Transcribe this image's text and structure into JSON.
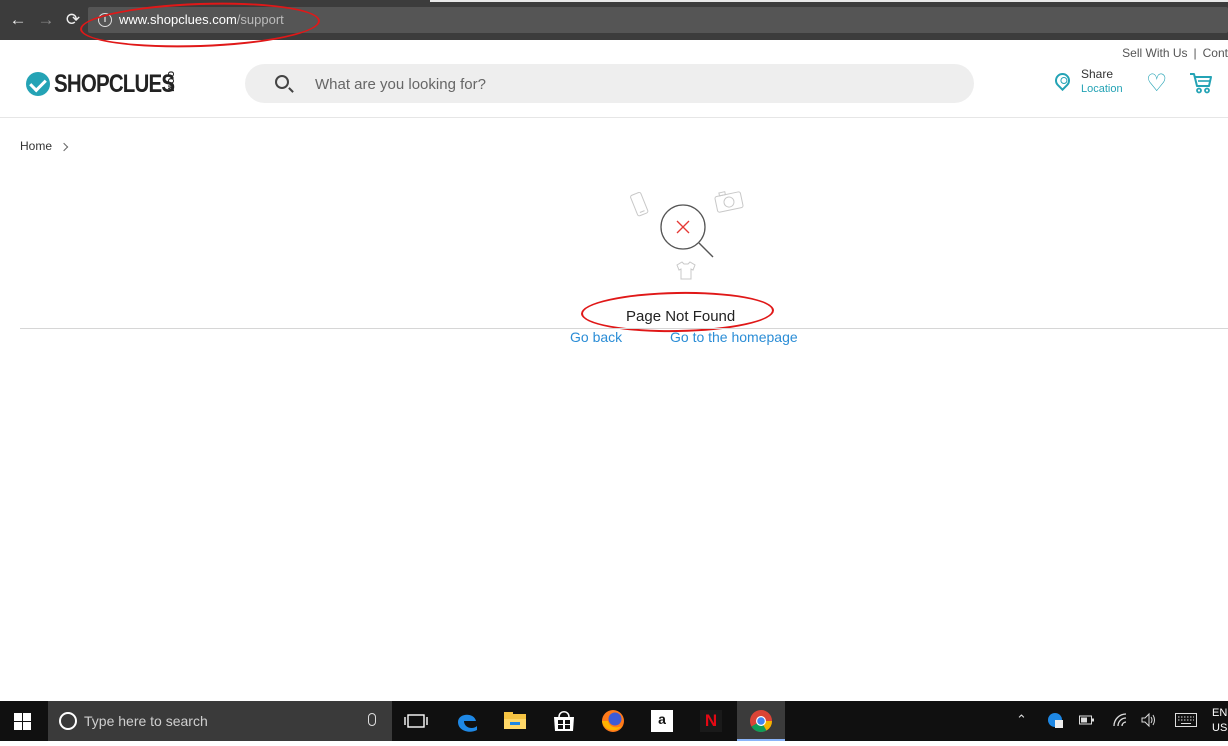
{
  "browser": {
    "back_glyph": "←",
    "forward_glyph": "→",
    "reload_glyph": "⟳",
    "info_glyph": "i",
    "url_host": "www.shopclues.com",
    "url_path": "/support"
  },
  "header": {
    "top_links": [
      "Sell With Us",
      "Cont"
    ],
    "top_separator": "|",
    "logo_word": "SHOPCLUES",
    "logo_suffix": "COM",
    "search_placeholder": "What are you looking for?",
    "share_label": "Share",
    "location_label": "Location",
    "heart_glyph": "♡"
  },
  "breadcrumb": {
    "home": "Home"
  },
  "error": {
    "title": "Page Not Found",
    "go_back": "Go back",
    "go_home": "Go to the homepage"
  },
  "taskbar": {
    "search_placeholder": "Type here to search",
    "amazon_glyph": "a",
    "netflix_glyph": "N",
    "tray_up_glyph": "⌃",
    "lang_line1": "EN",
    "lang_line2": "US"
  },
  "colors": {
    "brand": "#24a3b5",
    "link": "#2b8dd6",
    "annotation": "#e01818",
    "error_x": "#e53935"
  }
}
